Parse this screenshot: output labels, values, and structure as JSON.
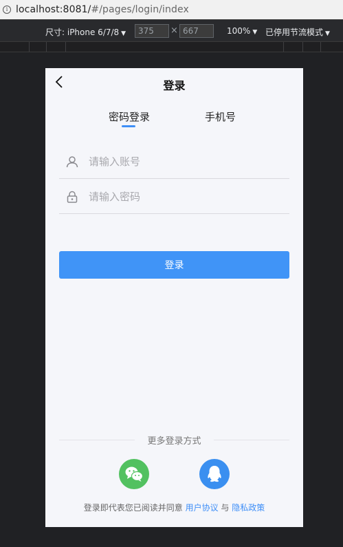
{
  "browser": {
    "url_host": "localhost:8081/",
    "url_path": "#/pages/login/index"
  },
  "device_toolbar": {
    "size_label": "尺寸: iPhone 6/7/8",
    "width": "375",
    "height": "667",
    "times": "×",
    "zoom": "100%",
    "throttle": "已停用节流模式"
  },
  "nav": {
    "title": "登录"
  },
  "tabs": [
    {
      "label": "密码登录",
      "active": true
    },
    {
      "label": "手机号",
      "active": false
    }
  ],
  "form": {
    "account_placeholder": "请输入账号",
    "password_placeholder": "请输入密码",
    "login_label": "登录"
  },
  "more": {
    "title": "更多登录方式"
  },
  "agreement": {
    "prefix": "登录即代表您已阅读并同意",
    "user_agreement": "用户协议",
    "and": "与",
    "privacy": "隐私政策"
  },
  "colors": {
    "accent": "#4094f7",
    "wechat": "#52c160",
    "qq": "#3a8ff0"
  }
}
